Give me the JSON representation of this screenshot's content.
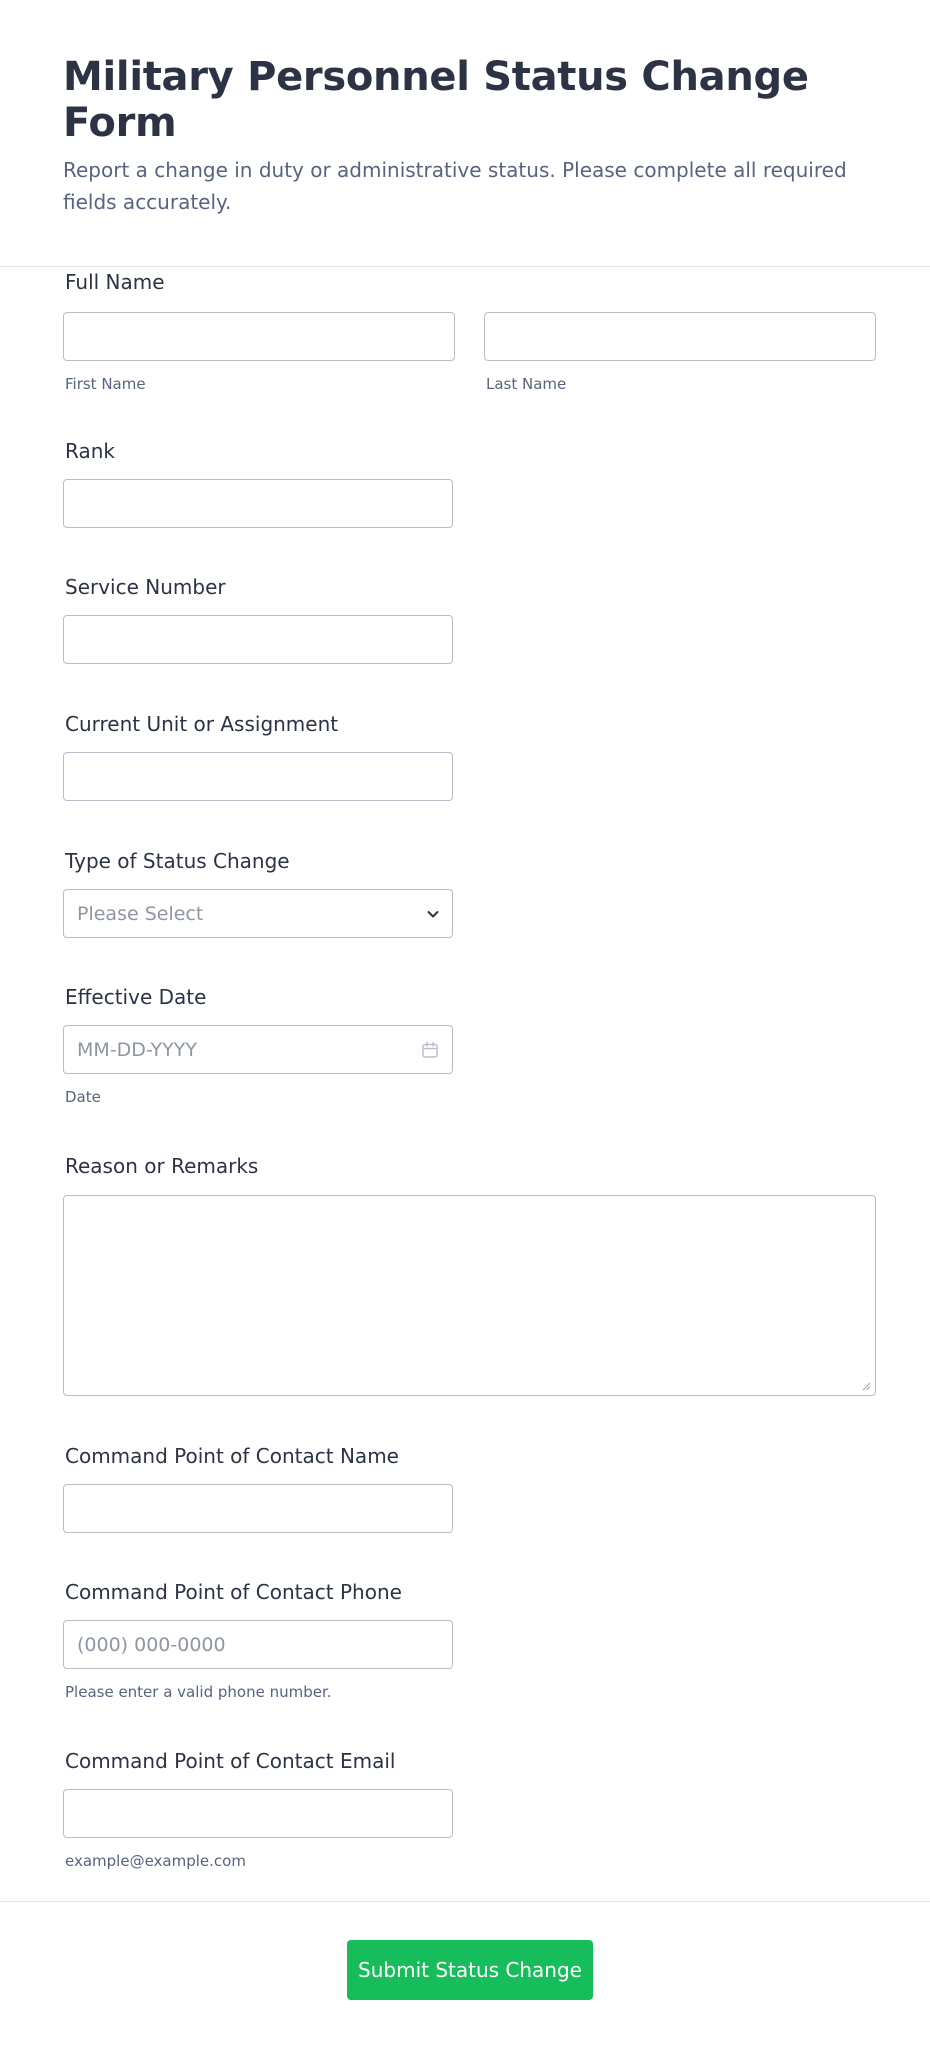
{
  "header": {
    "title": "Military Personnel Status Change Form",
    "subtitle": "Report a change in duty or administrative status. Please complete all required fields accurately."
  },
  "fields": {
    "full_name": {
      "label": "Full Name",
      "first_sublabel": "First Name",
      "last_sublabel": "Last Name"
    },
    "rank": {
      "label": "Rank"
    },
    "service_number": {
      "label": "Service Number"
    },
    "unit": {
      "label": "Current Unit or Assignment"
    },
    "status_type": {
      "label": "Type of Status Change",
      "selected": "Please Select"
    },
    "effective_date": {
      "label": "Effective Date",
      "placeholder": "MM-DD-YYYY",
      "sublabel": "Date"
    },
    "remarks": {
      "label": "Reason or Remarks"
    },
    "poc_name": {
      "label": "Command Point of Contact Name"
    },
    "poc_phone": {
      "label": "Command Point of Contact Phone",
      "placeholder": "(000) 000-0000",
      "sublabel": "Please enter a valid phone number."
    },
    "poc_email": {
      "label": "Command Point of Contact Email",
      "sublabel": "example@example.com"
    }
  },
  "submit": {
    "label": "Submit Status Change"
  },
  "icons": {
    "select_chevron": "chevron-down-icon",
    "date_picker": "calendar-icon",
    "textarea_grip": "resize-grip-icon"
  },
  "colors": {
    "accent": "#18bd5b",
    "text": "#2c3345",
    "muted": "#57647e",
    "border": "#b8bdc9"
  }
}
